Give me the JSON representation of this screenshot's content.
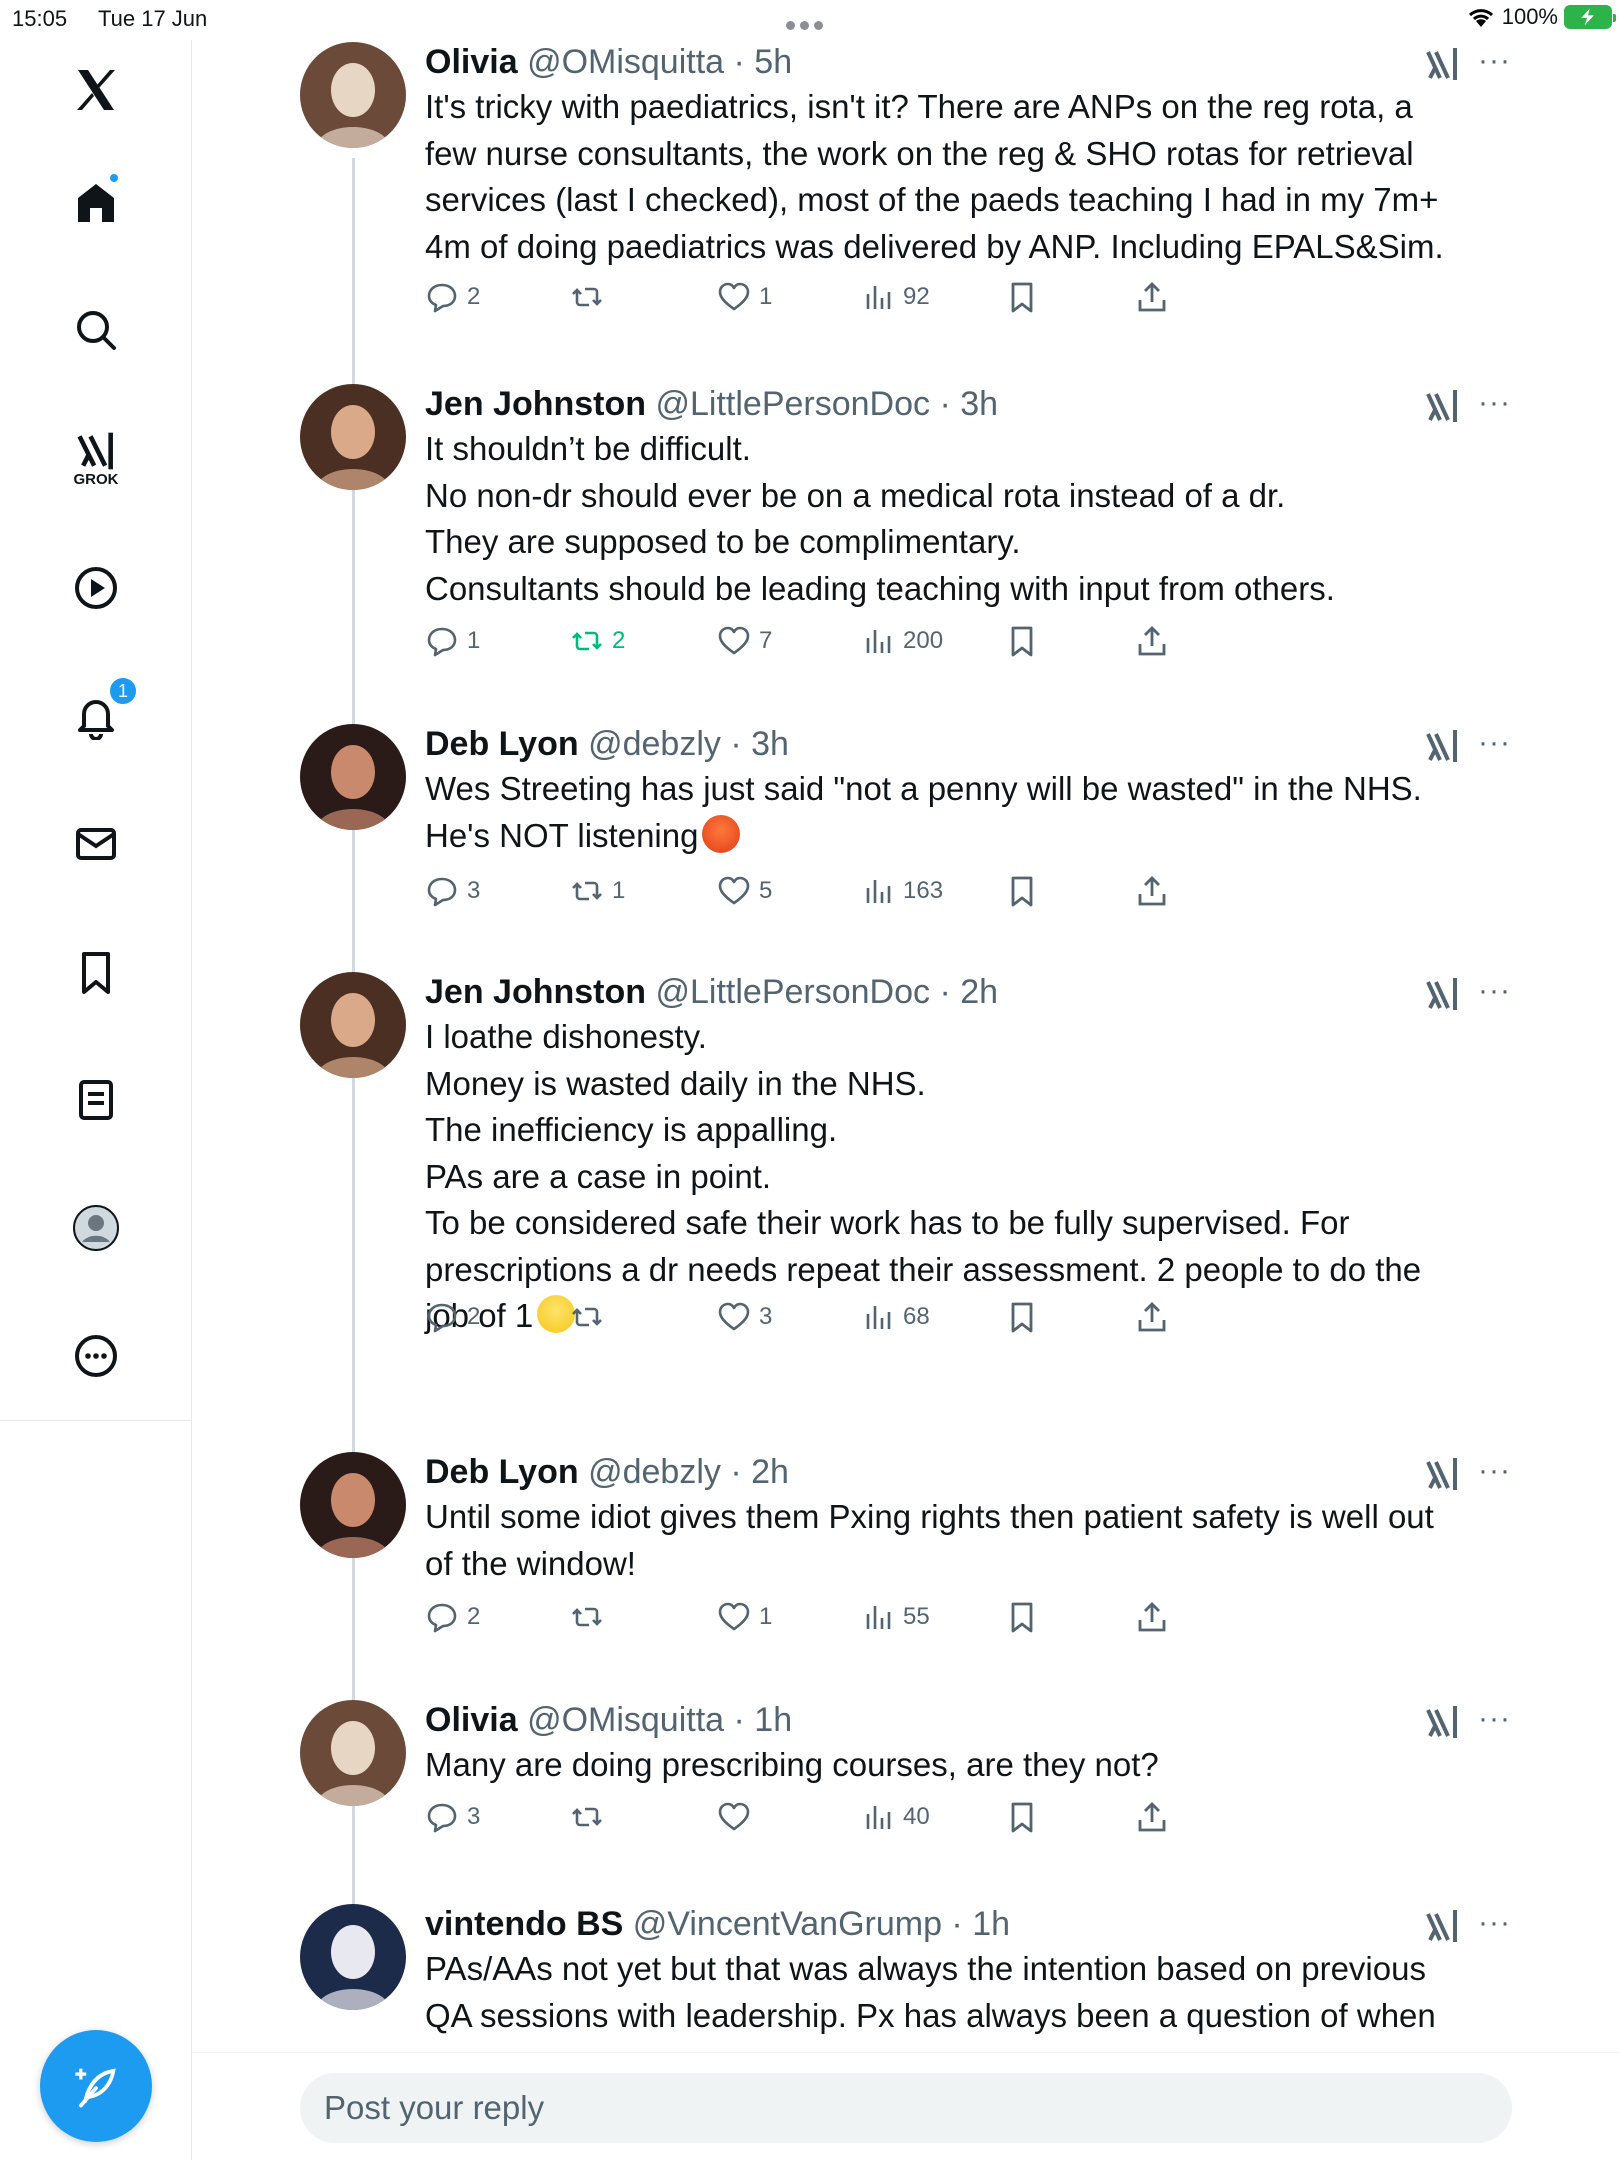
{
  "status_bar": {
    "time": "15:05",
    "date": "Tue 17 Jun",
    "battery": "100%"
  },
  "sidebar": {
    "grok_label": "GROK",
    "notification_count": "1",
    "items": [
      "x-logo",
      "home",
      "search",
      "grok",
      "video",
      "notifications",
      "messages",
      "bookmarks",
      "lists",
      "profile",
      "more"
    ]
  },
  "tweets": [
    {
      "name": "Olivia",
      "handle": "@OMisquitta",
      "time": "5h",
      "lines": [
        "It's tricky with paediatrics, isn't it? There are ANPs on the reg rota, a",
        "few nurse consultants, the work on the reg & SHO rotas for retrieval",
        "services (last I checked), most of the paeds teaching I had in my 7m+",
        "4m of doing paediatrics was delivered by ANP. Including EPALS&Sim."
      ],
      "replies": "2",
      "reposts": "",
      "likes": "1",
      "views": "92"
    },
    {
      "name": "Jen Johnston",
      "handle": "@LittlePersonDoc",
      "time": "3h",
      "lines": [
        "It shouldn’t be difficult.",
        "No non-dr should ever be on a medical rota instead of a dr.",
        "They are supposed to be complimentary.",
        "Consultants should be leading teaching with input from others."
      ],
      "replies": "1",
      "reposts": "2",
      "likes": "7",
      "views": "200"
    },
    {
      "name": "Deb Lyon",
      "handle": "@debzly",
      "time": "3h",
      "lines": [
        "Wes Streeting has just said \"not a penny will be wasted\" in the NHS.",
        "He's NOT listening"
      ],
      "replies": "3",
      "reposts": "1",
      "likes": "5",
      "views": "163"
    },
    {
      "name": "Jen Johnston",
      "handle": "@LittlePersonDoc",
      "time": "2h",
      "lines": [
        "I loathe dishonesty.",
        "Money is wasted daily in the NHS.",
        "The inefficiency is appalling.",
        "PAs are a case in point.",
        "To be considered safe their work has to be fully supervised. For",
        "prescriptions a dr needs repeat their assessment. 2 people to do the",
        "job of 1"
      ],
      "replies": "2",
      "reposts": "",
      "likes": "3",
      "views": "68"
    },
    {
      "name": "Deb Lyon",
      "handle": "@debzly",
      "time": "2h",
      "lines": [
        "Until some idiot gives them Pxing rights then patient safety is well out",
        "of the window!"
      ],
      "replies": "2",
      "reposts": "",
      "likes": "1",
      "views": "55"
    },
    {
      "name": "Olivia",
      "handle": "@OMisquitta",
      "time": "1h",
      "lines": [
        "Many are doing prescribing courses, are they not?"
      ],
      "replies": "3",
      "reposts": "",
      "likes": "",
      "views": "40"
    },
    {
      "name": "vintendo BS",
      "handle": "@VincentVanGrump",
      "time": "1h",
      "lines": [
        "PAs/AAs not yet but that was always the intention based on previous",
        "QA sessions with leadership. Px has always been a question of when"
      ],
      "replies": "",
      "reposts": "",
      "likes": "",
      "views": ""
    }
  ],
  "reply_bar": {
    "placeholder": "Post your reply"
  },
  "colors": {
    "accent": "#1d9bf0",
    "repost_active": "#00ba7c",
    "muted": "#536471"
  }
}
